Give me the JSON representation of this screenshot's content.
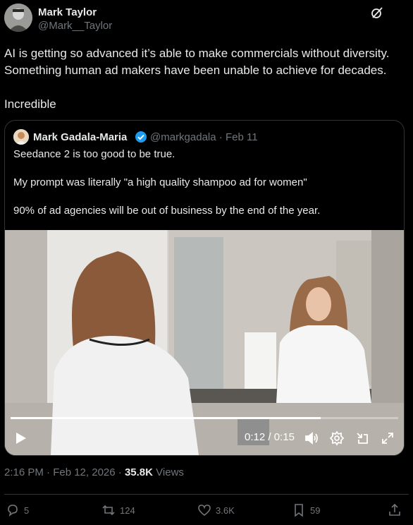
{
  "tweet": {
    "author_name": "Mark Taylor",
    "author_handle": "@Mark__Taylor",
    "text": "AI is getting so advanced it’s able to make commercials without diversity. Something human ad makers have been unable to achieve for decades.\n\nIncredible",
    "timestamp": "2:16 PM · Feb 12, 2026",
    "views_count": "35.8K",
    "views_label": "Views"
  },
  "quoted": {
    "author_name": "Mark Gadala-Maria",
    "author_handle": "@markgadala",
    "date": "Feb 11",
    "text": "Seedance 2 is too good to be true.\n\nMy prompt was literally \"a high quality shampoo ad for women\"\n\n90% of ad agencies will be out of business by the end of the year.",
    "video": {
      "current_time": "0:12",
      "duration": "0:15",
      "progress_fraction": 0.8
    }
  },
  "actions": {
    "replies": "5",
    "reposts": "124",
    "likes": "3.6K",
    "bookmarks": "59"
  },
  "icons": [
    "grok-icon",
    "verified-badge-icon",
    "play-icon",
    "volume-icon",
    "settings-icon",
    "minimize-icon",
    "fullscreen-icon",
    "reply-icon",
    "repost-icon",
    "like-icon",
    "bookmark-icon",
    "share-icon"
  ],
  "colors": {
    "background": "#000000",
    "text": "#e7e9ea",
    "muted": "#71767b",
    "verified": "#1d9bf0",
    "border": "#2f3336"
  }
}
